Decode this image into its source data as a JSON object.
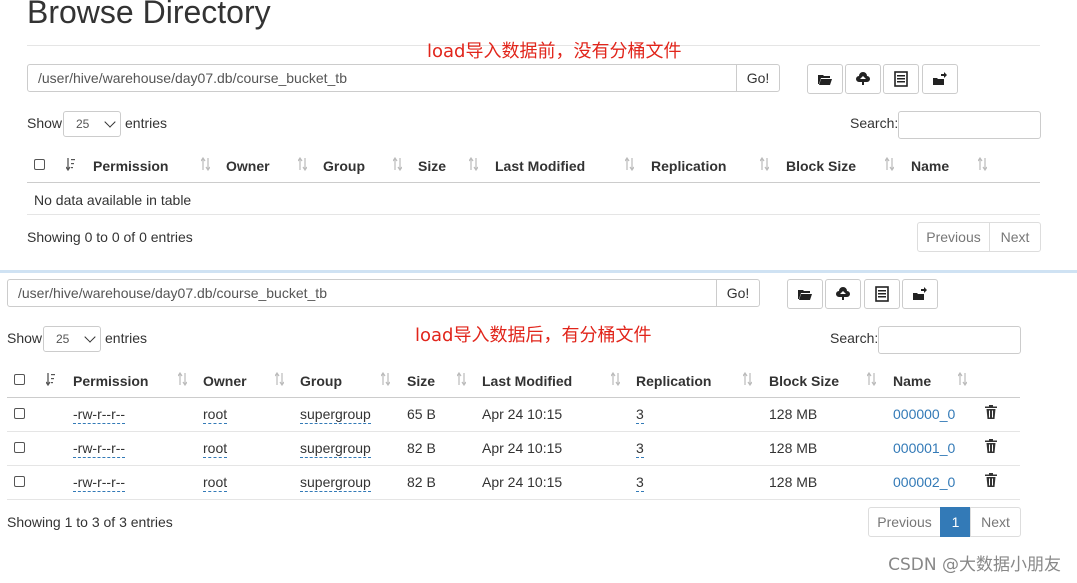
{
  "page_title": "Browse Directory",
  "annotation_before": "load导入数据前，没有分桶文件",
  "annotation_after": "load导入数据后，有分桶文件",
  "panel1": {
    "path": "/user/hive/warehouse/day07.db/course_bucket_tb",
    "go_label": "Go!",
    "show_label": "Show",
    "entries_value": "25",
    "entries_label": "entries",
    "search_label": "Search:",
    "columns": [
      "Permission",
      "Owner",
      "Group",
      "Size",
      "Last Modified",
      "Replication",
      "Block Size",
      "Name"
    ],
    "empty_message": "No data available in table",
    "info": "Showing 0 to 0 of 0 entries",
    "previous": "Previous",
    "next": "Next"
  },
  "panel2": {
    "path": "/user/hive/warehouse/day07.db/course_bucket_tb",
    "go_label": "Go!",
    "show_label": "Show",
    "entries_value": "25",
    "entries_label": "entries",
    "search_label": "Search:",
    "columns": [
      "Permission",
      "Owner",
      "Group",
      "Size",
      "Last Modified",
      "Replication",
      "Block Size",
      "Name"
    ],
    "rows": [
      {
        "permission": "-rw-r--r--",
        "owner": "root",
        "group": "supergroup",
        "size": "65 B",
        "modified": "Apr 24 10:15",
        "replication": "3",
        "block_size": "128 MB",
        "name": "000000_0"
      },
      {
        "permission": "-rw-r--r--",
        "owner": "root",
        "group": "supergroup",
        "size": "82 B",
        "modified": "Apr 24 10:15",
        "replication": "3",
        "block_size": "128 MB",
        "name": "000001_0"
      },
      {
        "permission": "-rw-r--r--",
        "owner": "root",
        "group": "supergroup",
        "size": "82 B",
        "modified": "Apr 24 10:15",
        "replication": "3",
        "block_size": "128 MB",
        "name": "000002_0"
      }
    ],
    "info": "Showing 1 to 3 of 3 entries",
    "previous": "Previous",
    "page": "1",
    "next": "Next"
  },
  "watermark": "CSDN @大数据小朋友",
  "colors": {
    "link": "#337ab7",
    "annotation": "#e1251b",
    "active_page": "#337ab7"
  }
}
